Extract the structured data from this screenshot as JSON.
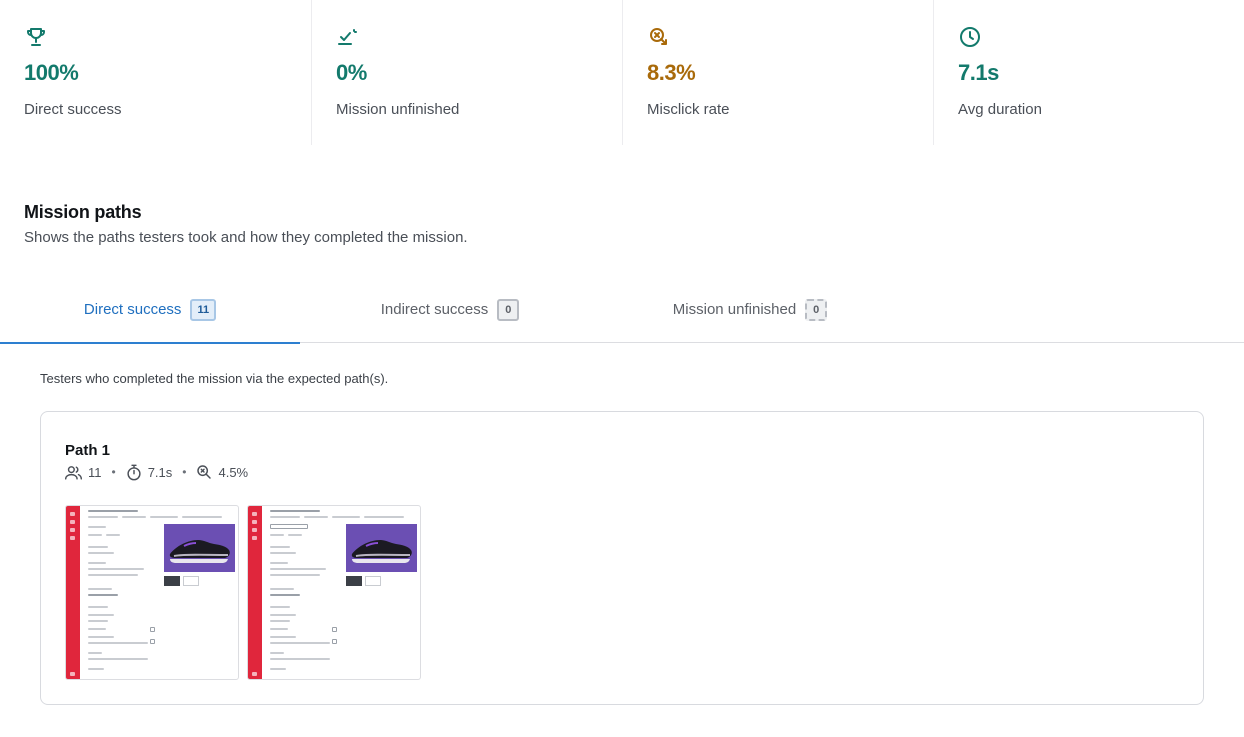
{
  "colors": {
    "accent": "#1f6fbf",
    "success": "#137a6c",
    "warning": "#a96a0a",
    "brand_red": "#e0263c"
  },
  "metrics": [
    {
      "icon": "trophy-icon",
      "value": "100%",
      "label": "Direct success",
      "tone": "teal"
    },
    {
      "icon": "mission-unfinished-icon",
      "value": "0%",
      "label": "Mission unfinished",
      "tone": "teal"
    },
    {
      "icon": "misclick-icon",
      "value": "8.3%",
      "label": "Misclick rate",
      "tone": "amber"
    },
    {
      "icon": "clock-icon",
      "value": "7.1s",
      "label": "Avg duration",
      "tone": "teal"
    }
  ],
  "mission_paths": {
    "title": "Mission paths",
    "subtitle": "Shows the paths testers took and how they completed the mission."
  },
  "tabs": [
    {
      "label": "Direct success",
      "count": "11",
      "active": true
    },
    {
      "label": "Indirect success",
      "count": "0",
      "active": false
    },
    {
      "label": "Mission unfinished",
      "count": "0",
      "active": false
    }
  ],
  "tab_description": "Testers who completed the mission via the expected path(s).",
  "path": {
    "title": "Path 1",
    "testers": "11",
    "duration": "7.1s",
    "misclick": "4.5%",
    "screens": [
      {
        "name": "screen-thumbnail-1"
      },
      {
        "name": "screen-thumbnail-2"
      }
    ]
  }
}
